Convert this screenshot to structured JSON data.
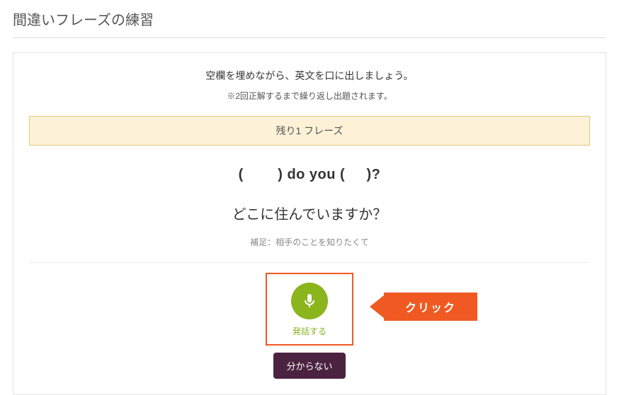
{
  "page_title": "間違いフレーズの練習",
  "card": {
    "instruction_main": "空欄を埋めながら、英文を口に出しましょう。",
    "instruction_sub": "※2回正解するまで繰り返し出題されます。",
    "remaining": "残り1 フレーズ",
    "cloze_sentence": "(        ) do you (     )?",
    "translation": "どこに住んでいますか？",
    "hint": "補足：相手のことを知りたくて",
    "speak_label": "発話する",
    "dont_know_label": "分からない"
  },
  "callout": {
    "text": "クリック"
  },
  "icons": {
    "mic": "microphone-icon"
  }
}
